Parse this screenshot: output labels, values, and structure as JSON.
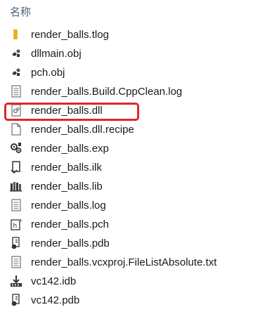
{
  "header": {
    "column_name": "名称"
  },
  "files": [
    {
      "name": "render_balls.tlog",
      "icon": "folder-icon"
    },
    {
      "name": "dllmain.obj",
      "icon": "object-file-icon"
    },
    {
      "name": "pch.obj",
      "icon": "object-file-icon"
    },
    {
      "name": "render_balls.Build.CppClean.log",
      "icon": "text-file-icon"
    },
    {
      "name": "render_balls.dll",
      "icon": "dll-file-icon",
      "highlighted": true
    },
    {
      "name": "render_balls.dll.recipe",
      "icon": "blank-file-icon"
    },
    {
      "name": "render_balls.exp",
      "icon": "exp-file-icon"
    },
    {
      "name": "render_balls.ilk",
      "icon": "ilk-file-icon"
    },
    {
      "name": "render_balls.lib",
      "icon": "lib-file-icon"
    },
    {
      "name": "render_balls.log",
      "icon": "text-file-icon"
    },
    {
      "name": "render_balls.pch",
      "icon": "pch-file-icon"
    },
    {
      "name": "render_balls.pdb",
      "icon": "pdb-file-icon"
    },
    {
      "name": "render_balls.vcxproj.FileListAbsolute.txt",
      "icon": "text-file-icon"
    },
    {
      "name": "vc142.idb",
      "icon": "idb-file-icon"
    },
    {
      "name": "vc142.pdb",
      "icon": "pdb-file-icon"
    }
  ],
  "colors": {
    "highlight_border": "#e0262a",
    "header_text": "#4c607a",
    "folder": "#f3c13a"
  }
}
